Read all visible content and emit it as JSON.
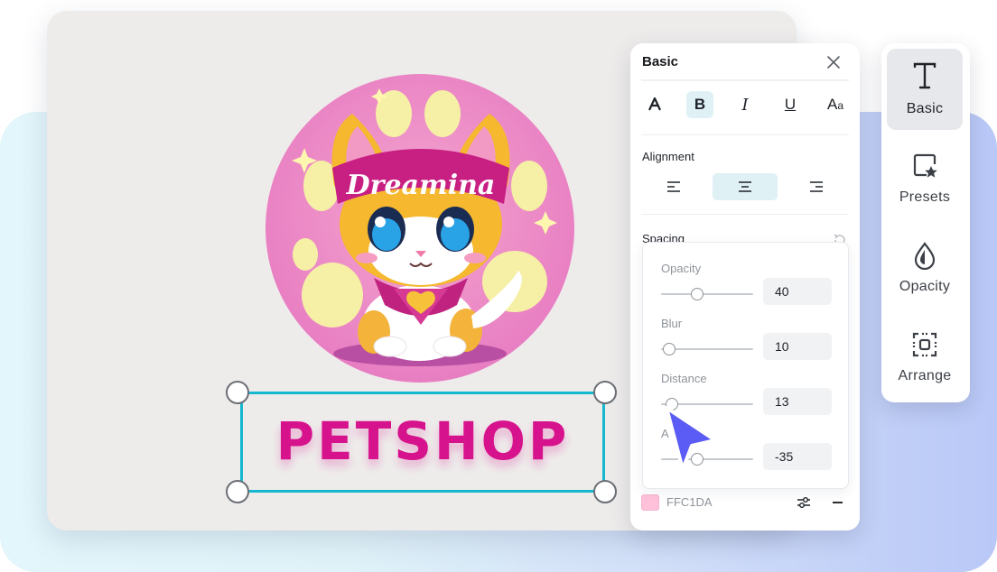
{
  "panel": {
    "title": "Basic",
    "style_buttons": [
      "font-color",
      "bold",
      "italic",
      "underline",
      "text-case"
    ],
    "active_style": "bold",
    "alignment_label": "Alignment",
    "active_alignment": "center",
    "spacing_label": "Spacing"
  },
  "shadow": {
    "opacity_label": "Opacity",
    "opacity_value": "40",
    "blur_label": "Blur",
    "blur_value": "10",
    "distance_label": "Distance",
    "distance_value": "13",
    "angle_label": "A",
    "angle_value": "-35",
    "color_hex": "FFC1DA",
    "color": "#FFC1DA"
  },
  "canvas": {
    "logo_text": "Dreamina",
    "text_layer": "PETSHOP",
    "text_color": "#D7128D"
  },
  "toolbar": {
    "items": [
      {
        "label": "Basic",
        "icon": "text-icon",
        "active": true
      },
      {
        "label": "Presets",
        "icon": "preset-icon",
        "active": false
      },
      {
        "label": "Opacity",
        "icon": "droplet-icon",
        "active": false
      },
      {
        "label": "Arrange",
        "icon": "arrange-icon",
        "active": false
      }
    ]
  },
  "colors": {
    "accent": "#16B8CF",
    "active_bg": "#DFF1F5",
    "cursor": "#5B5BF5"
  }
}
